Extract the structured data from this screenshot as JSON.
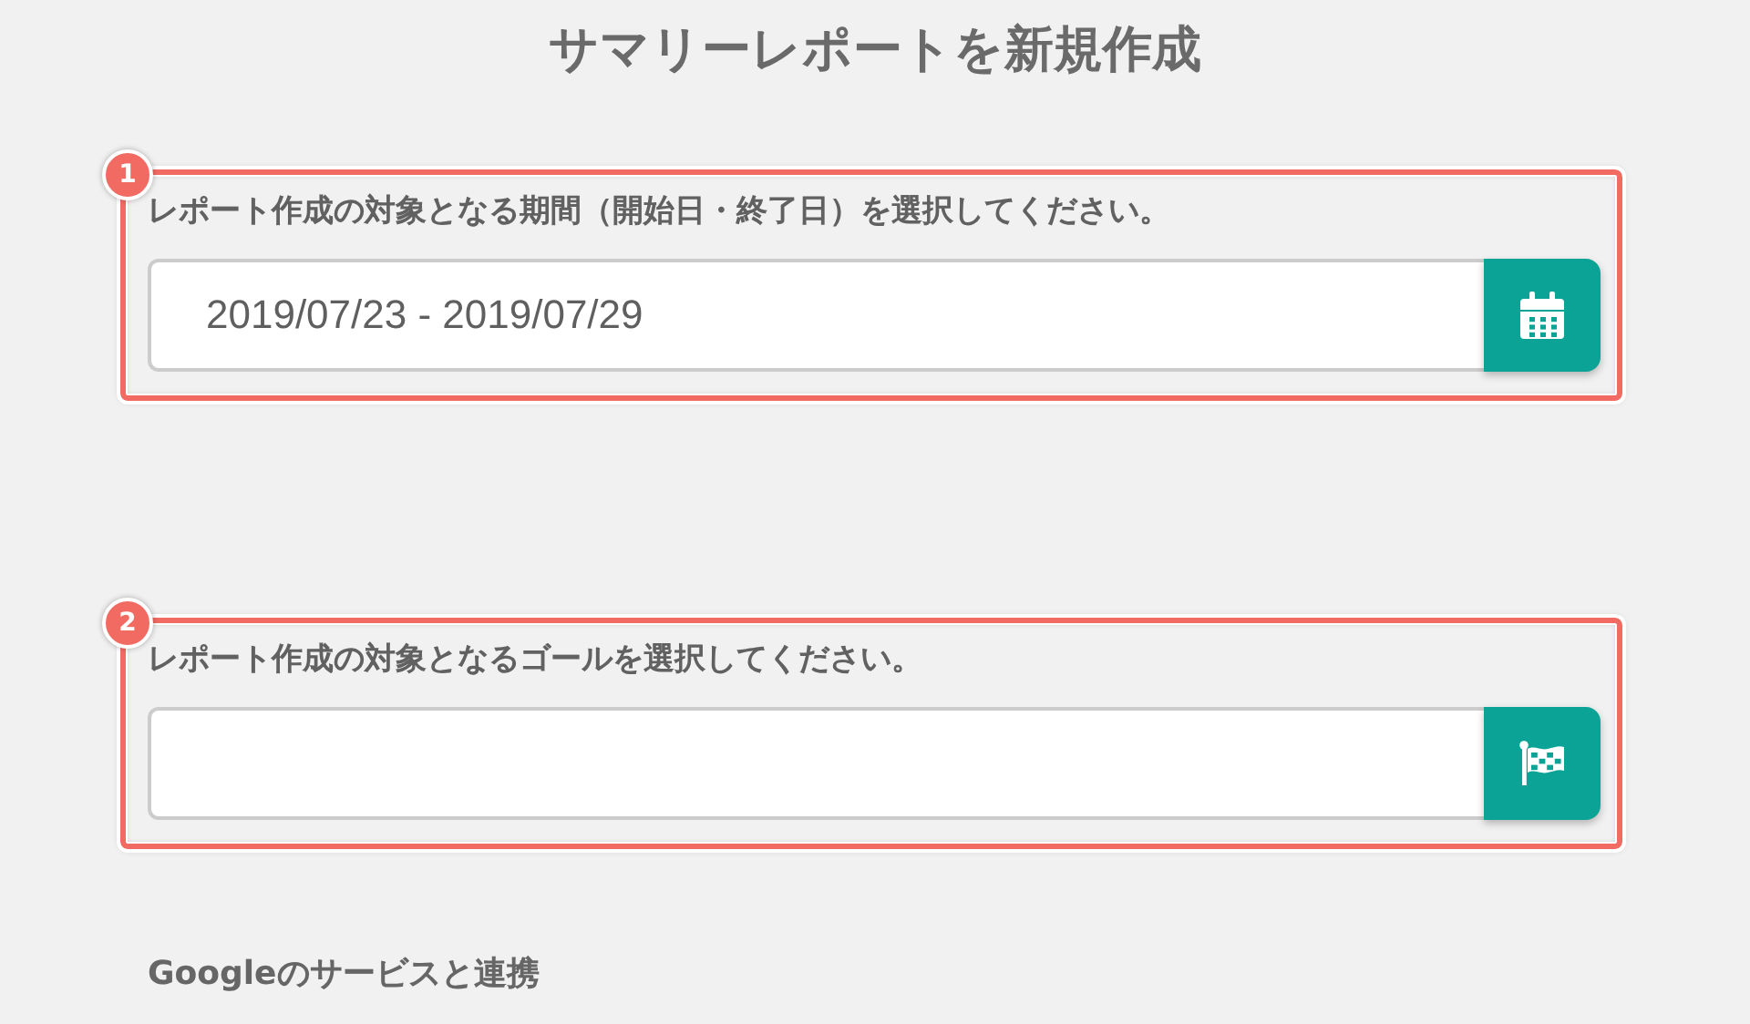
{
  "title": "サマリーレポートを新規作成",
  "sections": [
    {
      "badge": "1",
      "label": "レポート作成の対象となる期間（開始日・終了日）を選択してください。",
      "value": "2019/07/23 - 2019/07/29",
      "kind": "calendar"
    },
    {
      "badge": "2",
      "label": "レポート作成の対象となるゴールを選択してください。",
      "kind": "flag"
    }
  ],
  "footer_heading": "Googleのサービスと連携"
}
